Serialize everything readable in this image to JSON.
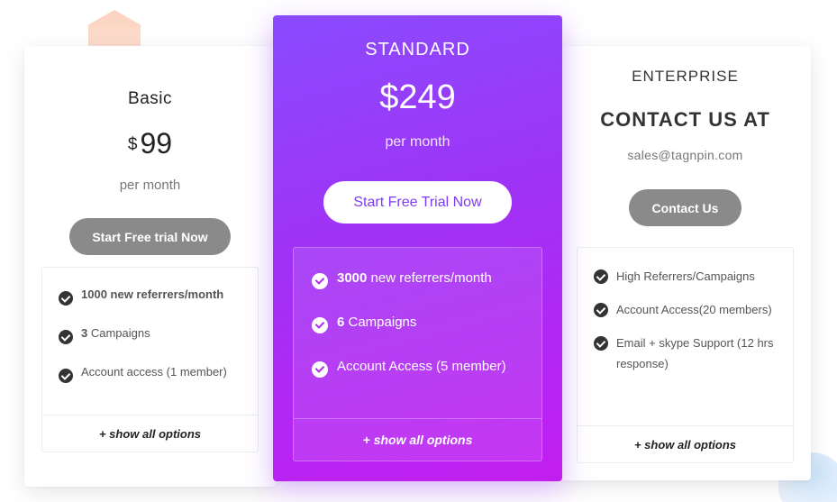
{
  "basic": {
    "title": "Basic",
    "currency": "$",
    "price": "99",
    "period": "per month",
    "cta": "Start Free trial Now",
    "features": [
      {
        "bold": "",
        "text": "1000 new referrers/month",
        "all_bold": true
      },
      {
        "bold": "3",
        "text": " Campaigns"
      },
      {
        "bold": "",
        "text": "Account access (1 member)"
      }
    ],
    "show_all": "+ show all options"
  },
  "standard": {
    "title": "STANDARD",
    "price": "$249",
    "period": "per month",
    "cta": "Start Free Trial Now",
    "features": [
      {
        "bold": "3000",
        "text": " new referrers/month"
      },
      {
        "bold": "6",
        "text": " Campaigns"
      },
      {
        "bold": "",
        "text": "Account Access (5 member)"
      }
    ],
    "show_all": "+ show all options"
  },
  "enterprise": {
    "title": "ENTERPRISE",
    "contact_heading": "CONTACT US AT",
    "email": "sales@tagnpin.com",
    "cta": "Contact Us",
    "features": [
      {
        "text": "High Referrers/Campaigns"
      },
      {
        "text": "Account Access(20 members)"
      },
      {
        "text": "Email + skype Support (12 hrs response)"
      }
    ],
    "show_all": "+ show all options"
  },
  "colors": {
    "accent_gradient_start": "#8a4bff",
    "accent_gradient_end": "#c21ef0",
    "button_gray": "#8a8a8a",
    "primary_text": "#7d3cf2"
  }
}
